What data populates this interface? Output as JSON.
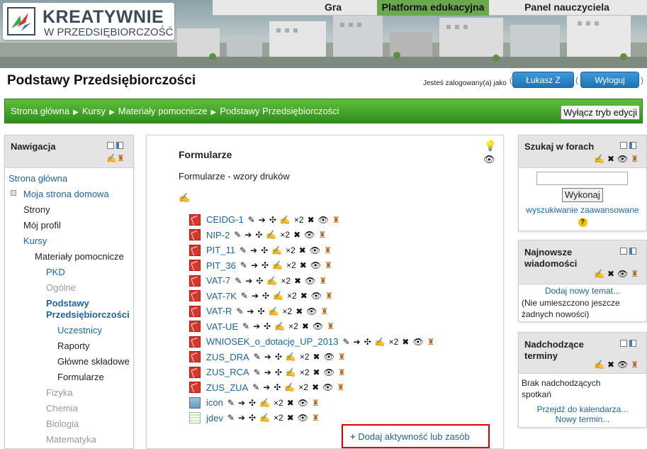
{
  "header": {
    "logo_line1": "KREATYWNIE",
    "logo_line2": "W PRZEDSIĘBIORCZOŚĆ",
    "nav": [
      {
        "label": "Gra",
        "active": false
      },
      {
        "label": "Platforma edukacyjna",
        "active": true
      },
      {
        "label": "Panel nauczyciela",
        "active": false
      }
    ]
  },
  "page": {
    "title": "Podstawy Przedsiębiorczości",
    "login_text": "Jesteś zalogowany(a) jako",
    "user_button": "Łukasz Z",
    "logout_button": "Wyloguj"
  },
  "breadcrumb": {
    "items": [
      "Strona główna",
      "Kursy",
      "Materiały pomocnicze",
      "Podstawy Przedsiębiorczości"
    ],
    "separator": "▶",
    "edit_button": "Wyłącz tryb edycji"
  },
  "navigation": {
    "title": "Nawigacja",
    "items": [
      {
        "label": "Strona główna",
        "style": "blue"
      },
      {
        "label": "Moja strona domowa",
        "style": "blue"
      },
      {
        "label": "Strony",
        "style": "dark"
      },
      {
        "label": "Mój profil",
        "style": "dark"
      },
      {
        "label": "Kursy",
        "style": "blue"
      },
      {
        "label": "Materiały pomocnicze",
        "style": "dark"
      },
      {
        "label": "PKD",
        "style": "blue"
      },
      {
        "label": "Ogólne",
        "style": "grey"
      },
      {
        "label": "Podstawy",
        "style": "current"
      },
      {
        "label": "Przedsiębiorczości",
        "style": "current"
      },
      {
        "label": "Uczestnicy",
        "style": "blue"
      },
      {
        "label": "Raporty",
        "style": "dark"
      },
      {
        "label": "Główne składowe",
        "style": "dark"
      },
      {
        "label": "Formularze",
        "style": "dark"
      },
      {
        "label": "Fizyka",
        "style": "grey"
      },
      {
        "label": "Chemia",
        "style": "grey"
      },
      {
        "label": "Biologia",
        "style": "grey"
      },
      {
        "label": "Matematyka",
        "style": "grey"
      }
    ]
  },
  "section": {
    "title": "Formularze",
    "summary": "Formularze - wzory druków",
    "resources": [
      {
        "name": "CEIDG-1",
        "type": "pdf"
      },
      {
        "name": "NIP-2",
        "type": "pdf"
      },
      {
        "name": "PIT_11",
        "type": "pdf"
      },
      {
        "name": "PIT_36",
        "type": "pdf"
      },
      {
        "name": "VAT-7",
        "type": "pdf"
      },
      {
        "name": "VAT-7K",
        "type": "pdf"
      },
      {
        "name": "VAT-R",
        "type": "pdf"
      },
      {
        "name": "VAT-UE",
        "type": "pdf"
      },
      {
        "name": "WNIOSEK_o_dotację_UP_2013",
        "type": "pdf"
      },
      {
        "name": "ZUS_DRA",
        "type": "pdf"
      },
      {
        "name": "ZUS_RCA",
        "type": "pdf"
      },
      {
        "name": "ZUS_ZUA",
        "type": "pdf"
      },
      {
        "name": "icon",
        "type": "image"
      },
      {
        "name": "jdev",
        "type": "text"
      }
    ],
    "edit_icons": [
      "pencil-icon",
      "move-right-icon",
      "move-icon",
      "edit-settings-icon",
      "duplicate-icon",
      "delete-icon",
      "visibility-icon",
      "roles-icon"
    ],
    "duplicate_label": "×2",
    "add_activity": "Dodaj aktywność lub zasób"
  },
  "search_forums": {
    "title": "Szukaj w forach",
    "button": "Wykonaj",
    "advanced": "wyszukiwanie zaawansowane"
  },
  "latest_news": {
    "title": "Najnowsze wiadomości",
    "title_line1": "Najnowsze",
    "title_line2": "wiadomości",
    "add_topic": "Dodaj nowy temat...",
    "empty_line1": "(Nie umieszczono jeszcze",
    "empty_line2": "żadnych nowości)"
  },
  "upcoming": {
    "title_line1": "Nadchodzące",
    "title_line2": "terminy",
    "empty_line1": "Brak nadchodzących",
    "empty_line2": "spotkań",
    "calendar_link": "Przejdź do kalendarza...",
    "new_event": "Nowy termin..."
  }
}
